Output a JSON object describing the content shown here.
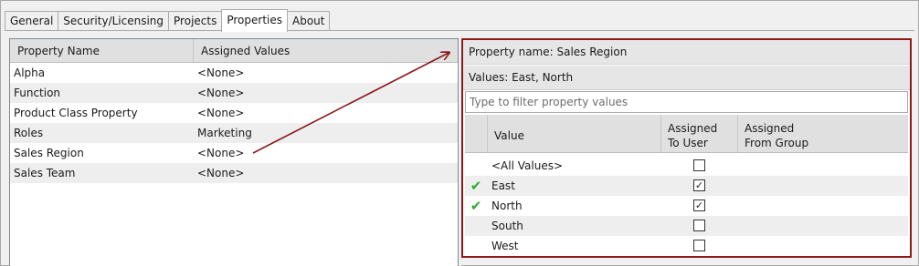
{
  "tabs": [
    {
      "label": "General",
      "active": false
    },
    {
      "label": "Security/Licensing",
      "active": false
    },
    {
      "label": "Projects",
      "active": false
    },
    {
      "label": "Properties",
      "active": true
    },
    {
      "label": "About",
      "active": false
    }
  ],
  "property_table": {
    "headers": {
      "name": "Property Name",
      "values": "Assigned Values"
    },
    "rows": [
      {
        "name": "Alpha",
        "value": "<None>"
      },
      {
        "name": "Function",
        "value": "<None>"
      },
      {
        "name": "Product Class Property",
        "value": "<None>"
      },
      {
        "name": "Roles",
        "value": "Marketing"
      },
      {
        "name": "Sales Region",
        "value": "<None>"
      },
      {
        "name": "Sales Team",
        "value": "<None>"
      }
    ]
  },
  "detail_panel": {
    "property_name": "Property name: Sales Region",
    "values_text": "Values: East, North",
    "filter_placeholder": "Type to filter property values",
    "filter_value": "",
    "headers": {
      "value": "Value",
      "to_user": "Assigned\nTo User",
      "to_user_line1": "Assigned",
      "to_user_line2": "To User",
      "from_group_line1": "Assigned",
      "from_group_line2": "From Group"
    },
    "rows": [
      {
        "value": "<All Values>",
        "assigned_to_user": false,
        "marked": false
      },
      {
        "value": "East",
        "assigned_to_user": true,
        "marked": true
      },
      {
        "value": "North",
        "assigned_to_user": true,
        "marked": true
      },
      {
        "value": "South",
        "assigned_to_user": false,
        "marked": false
      },
      {
        "value": "West",
        "assigned_to_user": false,
        "marked": false
      }
    ]
  },
  "icons": {
    "check_mark": "green-check-icon",
    "arrow": "annotation-arrow-icon"
  },
  "colors": {
    "highlight_border": "#8b1a1a",
    "arrow": "#8b1a1a",
    "check": "#2eab2e"
  }
}
